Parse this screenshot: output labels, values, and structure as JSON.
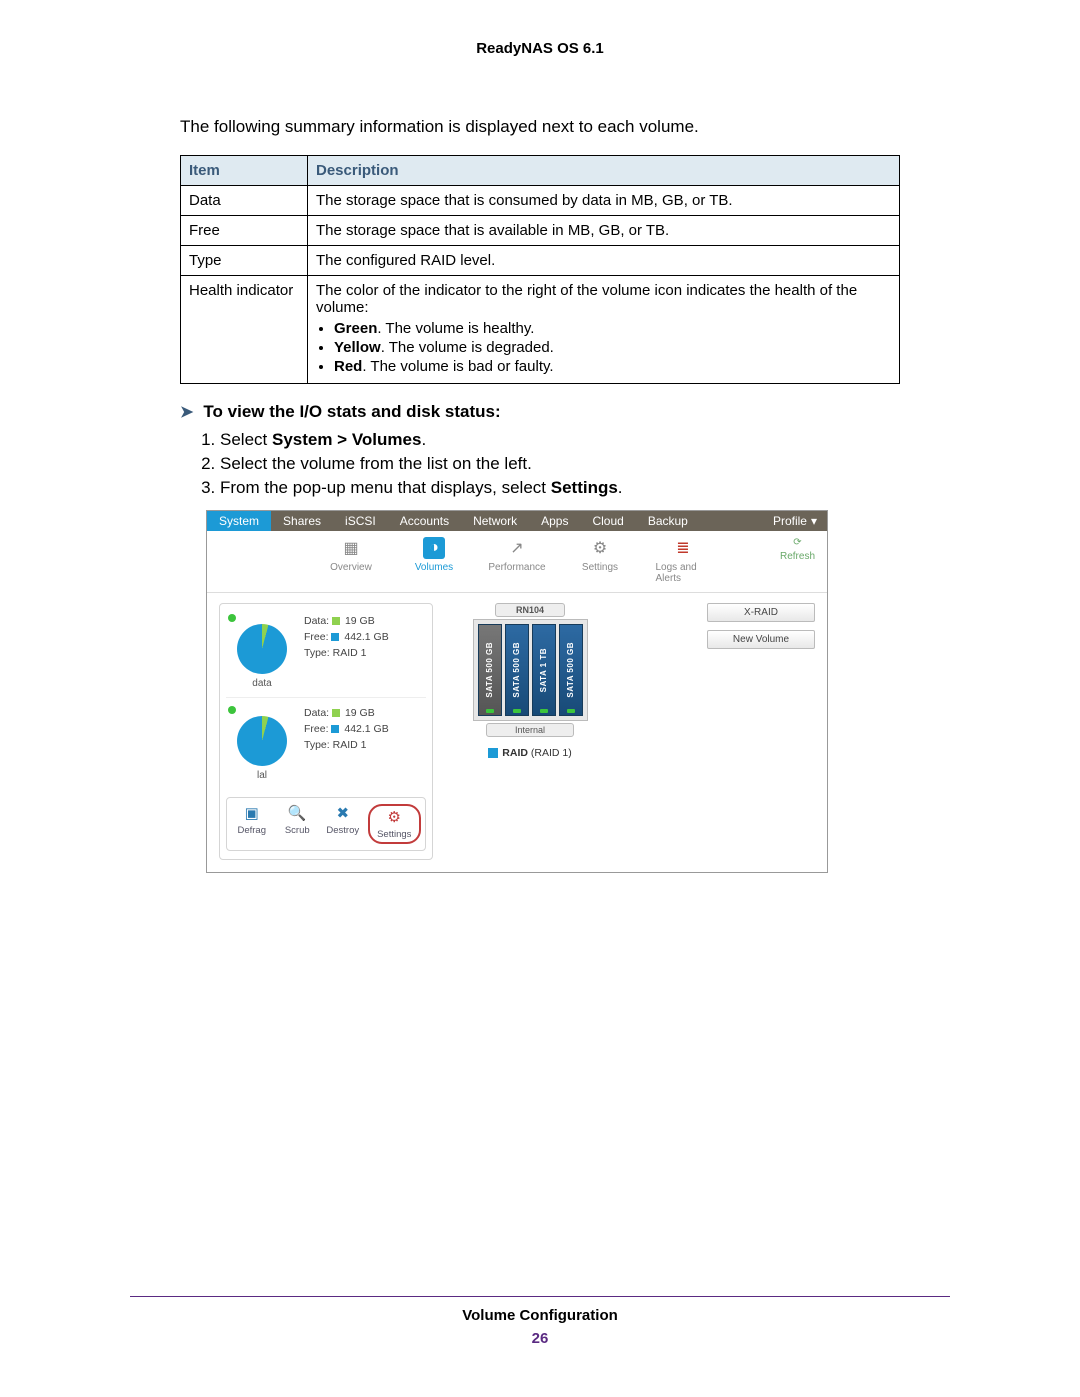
{
  "header": {
    "title": "ReadyNAS OS 6.1"
  },
  "intro": "The following summary information is displayed next to each volume.",
  "table": {
    "headers": {
      "item": "Item",
      "desc": "Description"
    },
    "rows": [
      {
        "item": "Data",
        "desc": "The storage space that is consumed by data in MB, GB, or TB."
      },
      {
        "item": "Free",
        "desc": "The storage space that is available in MB, GB, or TB."
      },
      {
        "item": "Type",
        "desc": "The configured RAID level."
      }
    ],
    "health": {
      "item": "Health indicator",
      "lead": "The color of the indicator to the right of the volume icon indicates the health of the volume:",
      "bullets": [
        {
          "b": "Green",
          "t": ". The volume is healthy."
        },
        {
          "b": "Yellow",
          "t": ". The volume is degraded."
        },
        {
          "b": "Red",
          "t": ". The volume is bad or faulty."
        }
      ]
    }
  },
  "section": {
    "title": "To view the I/O stats and disk status:"
  },
  "steps": {
    "s1a": "Select ",
    "s1b": "System > Volumes",
    "s1c": ".",
    "s2": "Select the volume from the list on the left.",
    "s3a": "From the pop-up menu that displays, select ",
    "s3b": "Settings",
    "s3c": "."
  },
  "shot": {
    "nav": {
      "tabs": [
        "System",
        "Shares",
        "iSCSI",
        "Accounts",
        "Network",
        "Apps",
        "Cloud",
        "Backup"
      ],
      "profile": "Profile"
    },
    "subnav": {
      "items": [
        {
          "label": "Overview",
          "glyph": "▦"
        },
        {
          "label": "Volumes",
          "glyph": "◑"
        },
        {
          "label": "Performance",
          "glyph": "↗"
        },
        {
          "label": "Settings",
          "glyph": "⚙"
        },
        {
          "label": "Logs and Alerts",
          "glyph": "≣"
        }
      ],
      "refresh": "Refresh"
    },
    "volumes": [
      {
        "name": "data",
        "data_label": "Data:",
        "data_value": "19 GB",
        "free_label": "Free:",
        "free_value": "442.1 GB",
        "type_label": "Type:",
        "type_value": "RAID 1",
        "data_color": "#8fd14f",
        "free_color": "#1c9ad6"
      },
      {
        "name": "lal",
        "data_label": "Data:",
        "data_value": "19 GB",
        "free_label": "Free:",
        "free_value": "442.1 GB",
        "type_label": "Type:",
        "type_value": "RAID 1",
        "data_color": "#8fd14f",
        "free_color": "#1c9ad6"
      }
    ],
    "actions": {
      "defrag": "Defrag",
      "scrub": "Scrub",
      "destroy": "Destroy",
      "settings": "Settings"
    },
    "device": {
      "model": "RN104",
      "internal": "Internal",
      "bays": [
        "SATA 500 GB",
        "SATA 500 GB",
        "SATA 1 TB",
        "SATA 500 GB"
      ],
      "raid_legend_b": "RAID",
      "raid_legend_p": " (RAID 1)"
    },
    "right": {
      "xraid": "X-RAID",
      "newvol": "New Volume"
    }
  },
  "footer": {
    "title": "Volume Configuration",
    "page": "26"
  }
}
